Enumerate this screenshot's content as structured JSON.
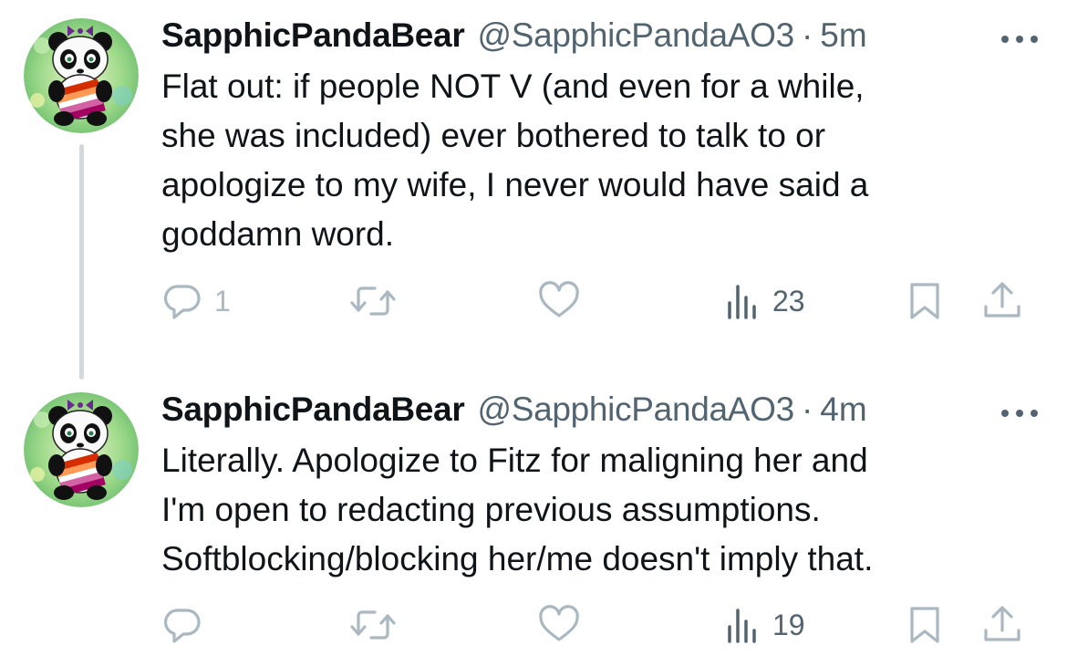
{
  "tweets": [
    {
      "display_name": "SapphicPandaBear",
      "handle": "@SapphicPandaAO3",
      "separator": "·",
      "time": "5m",
      "text": "Flat out: if people NOT V (and even for a while,\nshe was included) ever bothered to talk to or\napologize to my wife, I never would have said a\ngoddamn word.",
      "reply_count": "1",
      "views_count": "23"
    },
    {
      "display_name": "SapphicPandaBear",
      "handle": "@SapphicPandaAO3",
      "separator": "·",
      "time": "4m",
      "text": "Literally. Apologize to Fitz for maligning her and\nI'm open to redacting previous assumptions.\nSoftblocking/blocking her/me doesn't imply that.",
      "reply_count": "",
      "views_count": "19"
    }
  ],
  "colors": {
    "text_primary": "#0f1419",
    "text_secondary": "#536471",
    "icon_muted": "#aab8c2",
    "thread_line": "#cfd9de"
  },
  "icons": [
    "avatar-panda",
    "more-icon",
    "reply-icon",
    "retweet-icon",
    "like-icon",
    "views-icon",
    "bookmark-icon",
    "share-icon"
  ]
}
